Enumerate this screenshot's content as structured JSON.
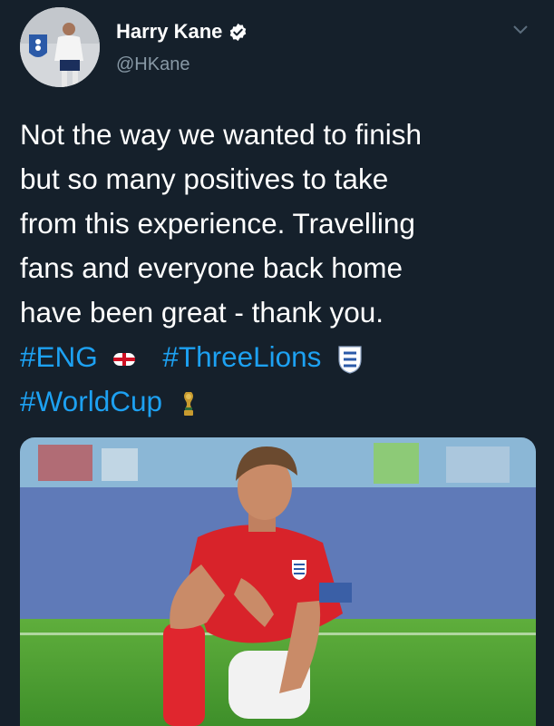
{
  "author": {
    "name": "Harry Kane",
    "handle": "@HKane",
    "verified": true,
    "avatar_icon": "england-player-avatar-icon"
  },
  "menu_icon": "chevron-down-icon",
  "tweet": {
    "lines": [
      "Not the way we wanted to finish",
      "but so many positives to take",
      "from this experience. Travelling",
      "fans and everyone back home",
      "have been great - thank you."
    ],
    "hashtags": [
      "#ENG",
      "#ThreeLions",
      "#WorldCup"
    ],
    "emojis": [
      "england-flag-icon",
      "three-lions-crest-icon",
      "world-cup-trophy-icon"
    ]
  },
  "colors": {
    "background": "#15202b",
    "text": "#ffffff",
    "secondary": "#8899a6",
    "link": "#1da1f2",
    "verified": "#ffffff"
  }
}
